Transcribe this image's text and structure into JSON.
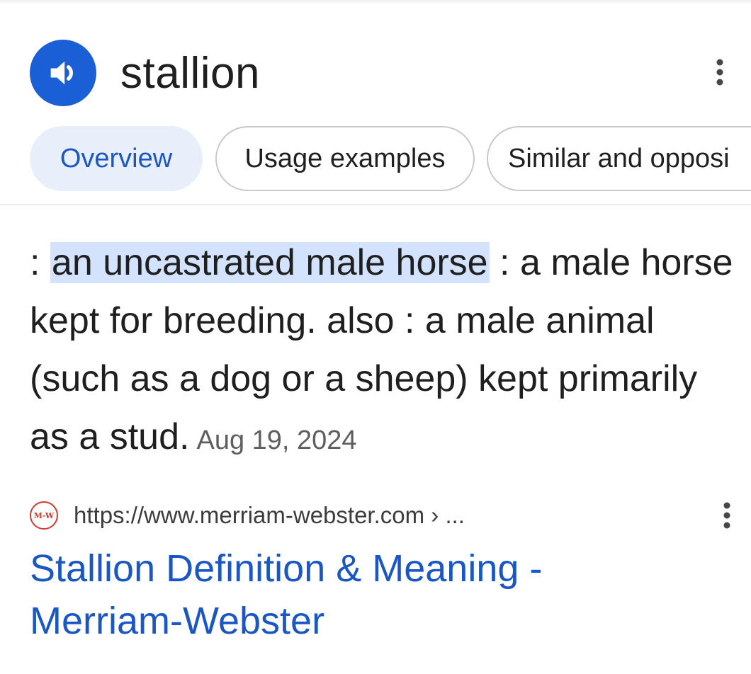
{
  "header": {
    "word": "stallion",
    "speaker_icon": "volume-up-icon",
    "more_icon": "more-vert-icon"
  },
  "tabs": [
    {
      "label": "Overview",
      "selected": true
    },
    {
      "label": "Usage examples",
      "selected": false
    },
    {
      "label": "Similar and opposi",
      "selected": false
    }
  ],
  "definition": {
    "prefix": ": ",
    "highlighted": "an uncastrated male horse",
    "rest": " : a male horse kept for breeding. also : a male animal (such as a dog or a sheep) kept primarily as a stud.",
    "date": "Aug 19, 2024"
  },
  "result": {
    "favicon_text": "M-W",
    "url": "https://www.merriam-webster.com › ...",
    "title": "Stallion Definition & Meaning - Merriam-Webster",
    "more_icon": "more-vert-icon"
  },
  "colors": {
    "accent_blue": "#1a5fd6",
    "link_blue": "#1a57c5",
    "highlight": "#d3e3fd",
    "selected_tab_bg": "#e8effb",
    "favicon_red": "#d33a2c"
  }
}
